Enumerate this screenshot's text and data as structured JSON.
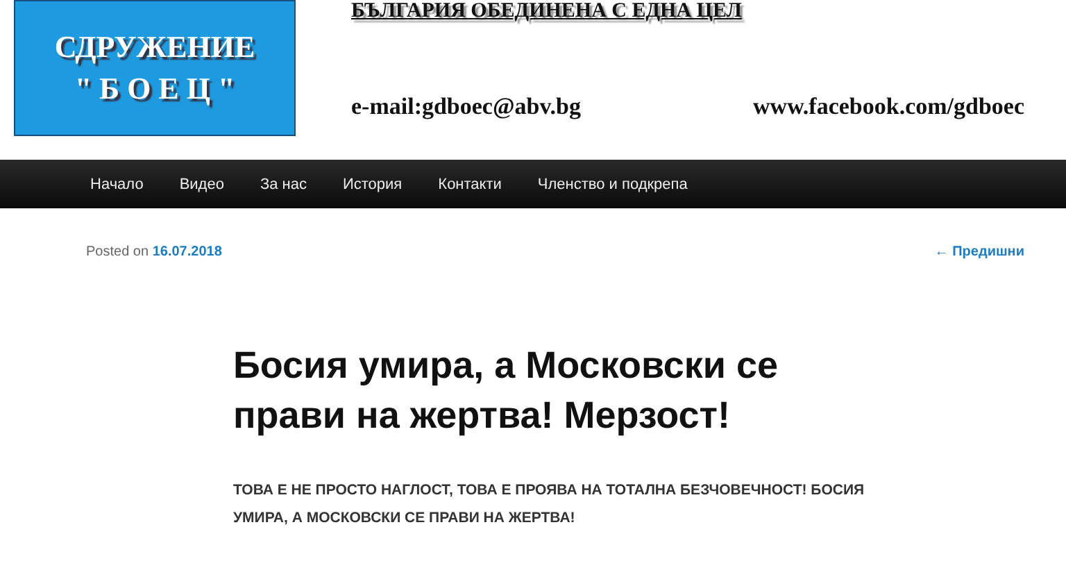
{
  "header": {
    "logo_lines": [
      "СДРУЖЕНИЕ",
      "\" Б О Е Ц \""
    ],
    "slogan": "БЪЛГАРИЯ ОБЕДИНЕНА С ЕДНА ЦЕЛ",
    "email": "e-mail:gdboec@abv.bg",
    "facebook": "www.facebook.com/gdboec"
  },
  "nav": {
    "items": [
      {
        "label": "Начало"
      },
      {
        "label": "Видео"
      },
      {
        "label": "За нас"
      },
      {
        "label": "История"
      },
      {
        "label": "Контакти"
      },
      {
        "label": "Членство и подкрепа"
      }
    ]
  },
  "post": {
    "posted_label": "Posted on",
    "date": "16.07.2018",
    "prev_link": "← Предишни",
    "title": "Босия умира, а Московски се прави на жертва! Мерзост!",
    "excerpt": "ТОВА Е НЕ ПРОСТО НАГЛОСТ, ТОВА Е ПРОЯВА НА ТОТАЛНА БЕЗЧОВЕЧНОСТ! БОСИЯ УМИРА, А МОСКОВСКИ СЕ ПРАВИ НА ЖЕРТВА!"
  }
}
